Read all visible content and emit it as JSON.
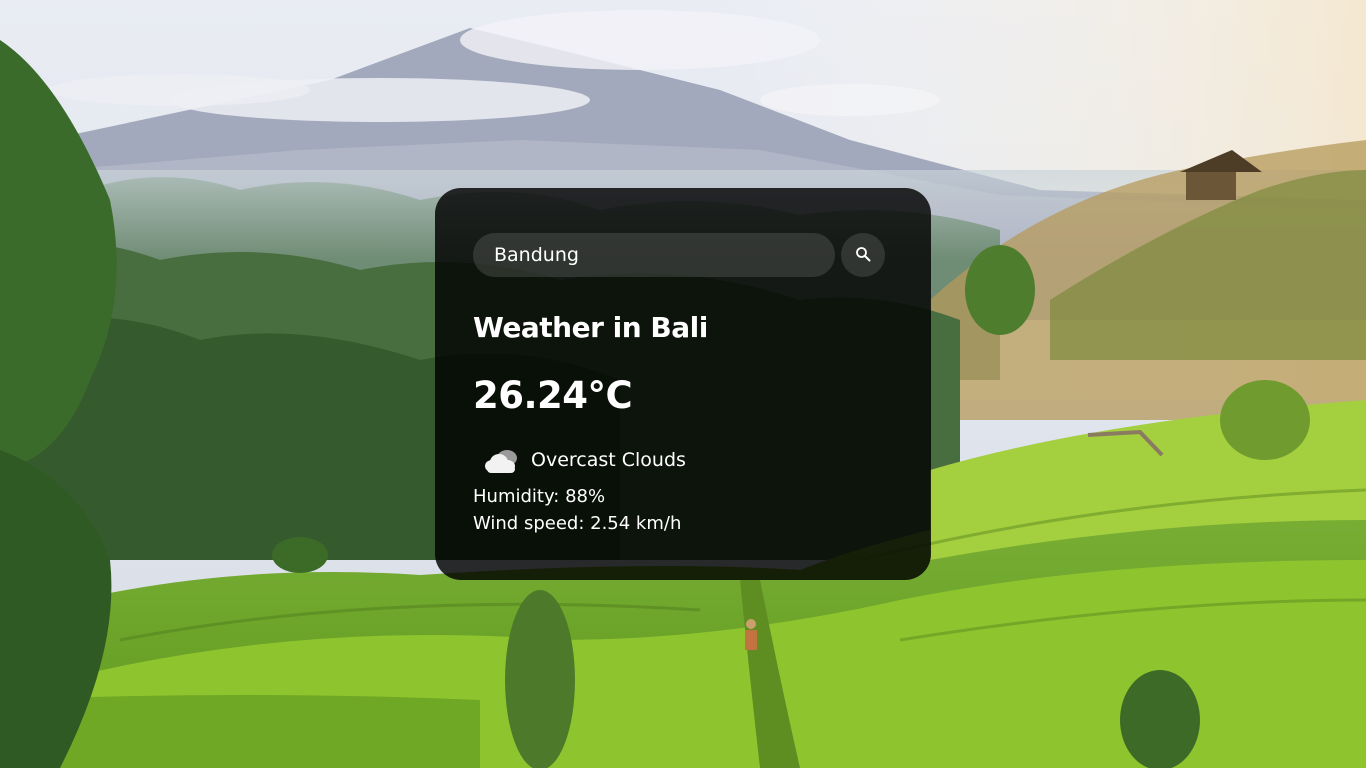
{
  "search": {
    "value": "Bandung",
    "icon": "search-icon"
  },
  "weather": {
    "title": "Weather in Bali",
    "temperature": "26.24°C",
    "condition_icon": "cloud-icon",
    "description": "Overcast Clouds",
    "humidity": "Humidity: 88%",
    "wind": "Wind speed: 2.54 km/h"
  },
  "background": {
    "scene": "mountain-rice-terraces",
    "sky_color": "#dfe4ee",
    "mountain_color": "#9aa1b8",
    "forest_color": "#3f6a3a",
    "field_color": "#8cc22e"
  }
}
